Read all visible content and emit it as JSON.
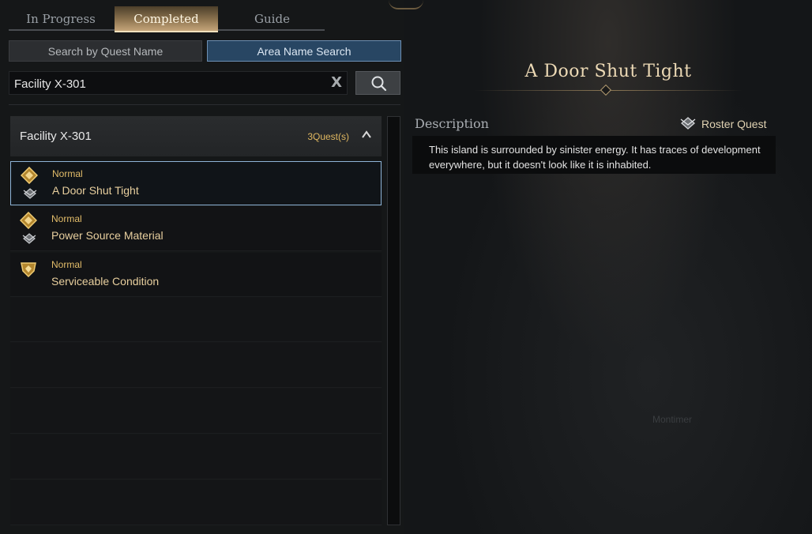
{
  "tabs": {
    "in_progress": "In Progress",
    "completed": "Completed",
    "guide": "Guide",
    "active": "Completed"
  },
  "search_modes": {
    "by_quest_name": "Search by Quest Name",
    "area_name": "Area Name Search",
    "active": "Area Name Search"
  },
  "search": {
    "value": "Facility X-301",
    "clear_icon": "close-icon",
    "button_icon": "search-icon"
  },
  "area": {
    "name": "Facility X-301",
    "count": "3Quest(s)",
    "expanded": true
  },
  "quests": [
    {
      "type": "Normal",
      "title": "A Door Shut Tight",
      "icon": "quest-diamond-icon",
      "roster": true,
      "selected": true
    },
    {
      "type": "Normal",
      "title": "Power Source Material",
      "icon": "quest-diamond-icon",
      "roster": true,
      "selected": false
    },
    {
      "type": "Normal",
      "title": "Serviceable Condition",
      "icon": "quest-shield-icon",
      "roster": false,
      "selected": false
    }
  ],
  "detail": {
    "title": "A Door Shut Tight",
    "description_label": "Description",
    "roster_label": "Roster Quest",
    "description": "This island is surrounded by sinister energy. It has traces of development everywhere, but it doesn't look like it is inhabited."
  },
  "background_labels": {
    "map_label": "Montimer"
  },
  "colors": {
    "accent_gold": "#e3bd6a",
    "selected_border": "#8eb4d7",
    "active_mode_bg": "#284663"
  }
}
